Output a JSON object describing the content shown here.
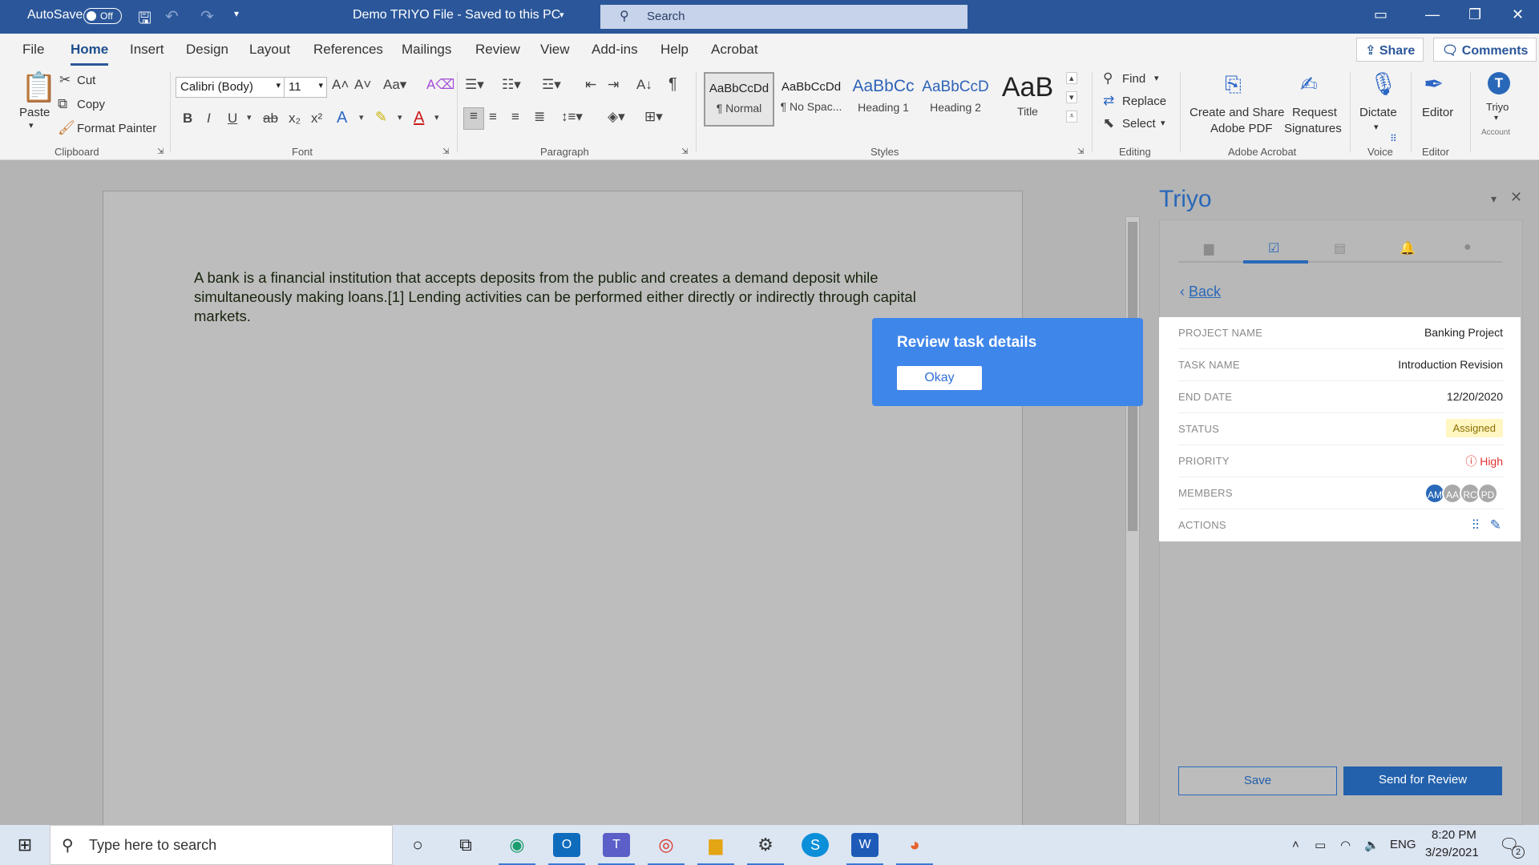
{
  "titlebar": {
    "autosave_label": "AutoSave",
    "autosave_state": "Off",
    "doc_title": "Demo TRIYO File - Saved to this PC",
    "search_placeholder": "Search"
  },
  "tabs": [
    "File",
    "Home",
    "Insert",
    "Design",
    "Layout",
    "References",
    "Mailings",
    "Review",
    "View",
    "Add-ins",
    "Help",
    "Acrobat"
  ],
  "active_tab": "Home",
  "share_label": "Share",
  "comments_label": "Comments",
  "ribbon": {
    "clipboard": {
      "paste": "Paste",
      "cut": "Cut",
      "copy": "Copy",
      "format_painter": "Format Painter",
      "group": "Clipboard"
    },
    "font": {
      "family": "Calibri (Body)",
      "size": "11",
      "group": "Font"
    },
    "paragraph": {
      "group": "Paragraph"
    },
    "styles": {
      "tiles": [
        {
          "sample": "AaBbCcDd",
          "name": "¶ Normal"
        },
        {
          "sample": "AaBbCcDd",
          "name": "¶ No Spac..."
        },
        {
          "sample": "AaBbCc",
          "name": "Heading 1"
        },
        {
          "sample": "AaBbCcD",
          "name": "Heading 2"
        },
        {
          "sample": "AaB",
          "name": "Title"
        }
      ],
      "group": "Styles"
    },
    "editing": {
      "find": "Find",
      "replace": "Replace",
      "select": "Select",
      "group": "Editing"
    },
    "acrobat": {
      "create_share_1": "Create and Share",
      "create_share_2": "Adobe PDF",
      "request_1": "Request",
      "request_2": "Signatures",
      "group": "Adobe Acrobat"
    },
    "voice": {
      "dictate": "Dictate",
      "group": "Voice"
    },
    "editor": {
      "editor": "Editor",
      "group": "Editor"
    },
    "account": {
      "triyo": "Triyo",
      "account": "Account"
    }
  },
  "document": {
    "text": "A bank is a financial institution that accepts deposits from the public and creates a demand deposit while simultaneously making loans.[1] Lending activities can be performed either directly or indirectly through capital markets."
  },
  "popup": {
    "title": "Review task details",
    "ok": "Okay"
  },
  "panel": {
    "title": "Triyo",
    "back": "Back",
    "rows": [
      {
        "key": "PROJECT NAME",
        "value": "Banking Project"
      },
      {
        "key": "TASK NAME",
        "value": "Introduction Revision"
      },
      {
        "key": "END DATE",
        "value": "12/20/2020"
      },
      {
        "key": "STATUS",
        "value": "Assigned"
      },
      {
        "key": "PRIORITY",
        "value": "High"
      },
      {
        "key": "MEMBERS",
        "value": ""
      },
      {
        "key": "ACTIONS",
        "value": ""
      }
    ],
    "members": [
      {
        "initials": "AM",
        "color": "#2968b8"
      },
      {
        "initials": "AA",
        "color": "#a9a9a9"
      },
      {
        "initials": "RC",
        "color": "#a9a9a9"
      },
      {
        "initials": "PD",
        "color": "#a9a9a9"
      }
    ],
    "save": "Save",
    "send": "Send for Review"
  },
  "taskbar": {
    "search_placeholder": "Type here to search",
    "lang": "ENG",
    "time": "8:20 PM",
    "date": "3/29/2021",
    "notif_count": "2"
  }
}
